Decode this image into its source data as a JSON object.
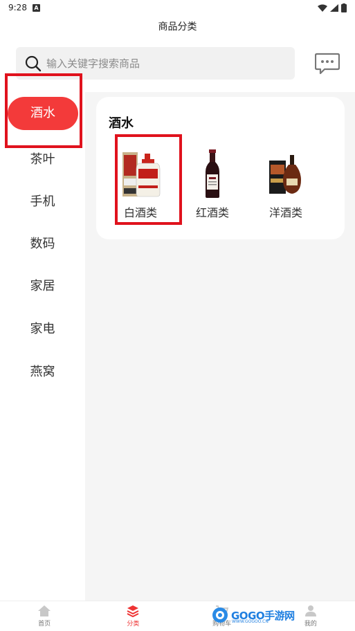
{
  "status_bar": {
    "time": "9:28",
    "notif_icon": "A"
  },
  "header": {
    "title": "商品分类"
  },
  "search": {
    "placeholder": "输入关键字搜索商品"
  },
  "sidebar": {
    "items": [
      {
        "label": "酒水",
        "active": true
      },
      {
        "label": "茶叶"
      },
      {
        "label": "手机"
      },
      {
        "label": "数码"
      },
      {
        "label": "家居"
      },
      {
        "label": "家电"
      },
      {
        "label": "燕窝"
      }
    ]
  },
  "category": {
    "title": "酒水",
    "products": [
      {
        "label": "白酒类",
        "icon": "baijiu-bottle-image"
      },
      {
        "label": "红酒类",
        "icon": "red-wine-bottle-image"
      },
      {
        "label": "洋酒类",
        "icon": "cognac-bottle-image"
      }
    ]
  },
  "bottom_nav": {
    "items": [
      {
        "label": "首页",
        "icon": "home-icon"
      },
      {
        "label": "分类",
        "icon": "layers-icon",
        "active": true
      },
      {
        "label": "购物车",
        "icon": "cart-icon"
      },
      {
        "label": "我的",
        "icon": "person-icon"
      }
    ]
  },
  "watermark": {
    "brand": "GOGO手游网",
    "url": "WWW.GOGOO.CN"
  },
  "colors": {
    "accent": "#f33a3a",
    "highlight": "#e0121d",
    "panel_bg": "#f5f5f5"
  }
}
